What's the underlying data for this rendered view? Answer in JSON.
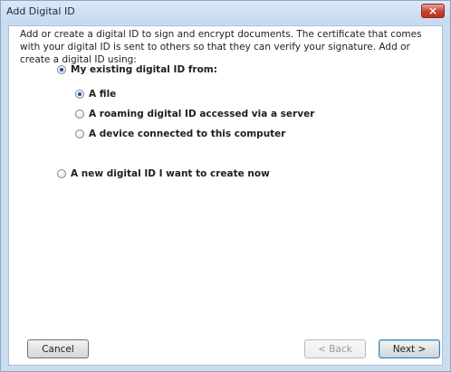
{
  "window": {
    "title": "Add Digital ID",
    "close_label": "×"
  },
  "intro_text": "Add or create a digital ID to sign and encrypt documents. The certificate that comes with your digital ID is sent to others so that they can verify your signature. Add or create a digital ID using:",
  "options": {
    "existing": {
      "label": "My existing digital ID from:",
      "selected": true
    },
    "sub": [
      {
        "label": "A file",
        "selected": true
      },
      {
        "label": "A roaming digital ID accessed via a server",
        "selected": false
      },
      {
        "label": "A device connected to this computer",
        "selected": false
      }
    ],
    "new_id": {
      "label": "A new digital ID I want to create now",
      "selected": false
    }
  },
  "buttons": {
    "cancel": "Cancel",
    "back": "< Back",
    "next": "Next >"
  }
}
